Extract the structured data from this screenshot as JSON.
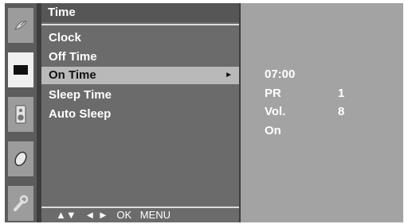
{
  "menu": {
    "title": "Time",
    "items": [
      {
        "label": "Clock"
      },
      {
        "label": "Off Time"
      },
      {
        "label": "On Time",
        "arrow": "►"
      },
      {
        "label": "Sleep Time"
      },
      {
        "label": "Auto Sleep"
      }
    ],
    "selected_index": 2,
    "footer": {
      "updown": "▲▼",
      "leftright": "◄ ►",
      "ok": "OK",
      "menu": "MENU"
    }
  },
  "rail": {
    "icons": [
      "satellite-dish-icon",
      "screen-icon",
      "speaker-icon",
      "clock-icon",
      "wrench-icon"
    ],
    "active_index": 1
  },
  "values": {
    "time": "07:00",
    "pr_label": "PR",
    "pr_value": "1",
    "vol_label": "Vol.",
    "vol_value": "8",
    "state": "On"
  },
  "colors": {
    "selected_bg": "#b9b9b9",
    "panel_bg": "#6b6b6b",
    "value_panel_bg": "#a3a3a3"
  }
}
